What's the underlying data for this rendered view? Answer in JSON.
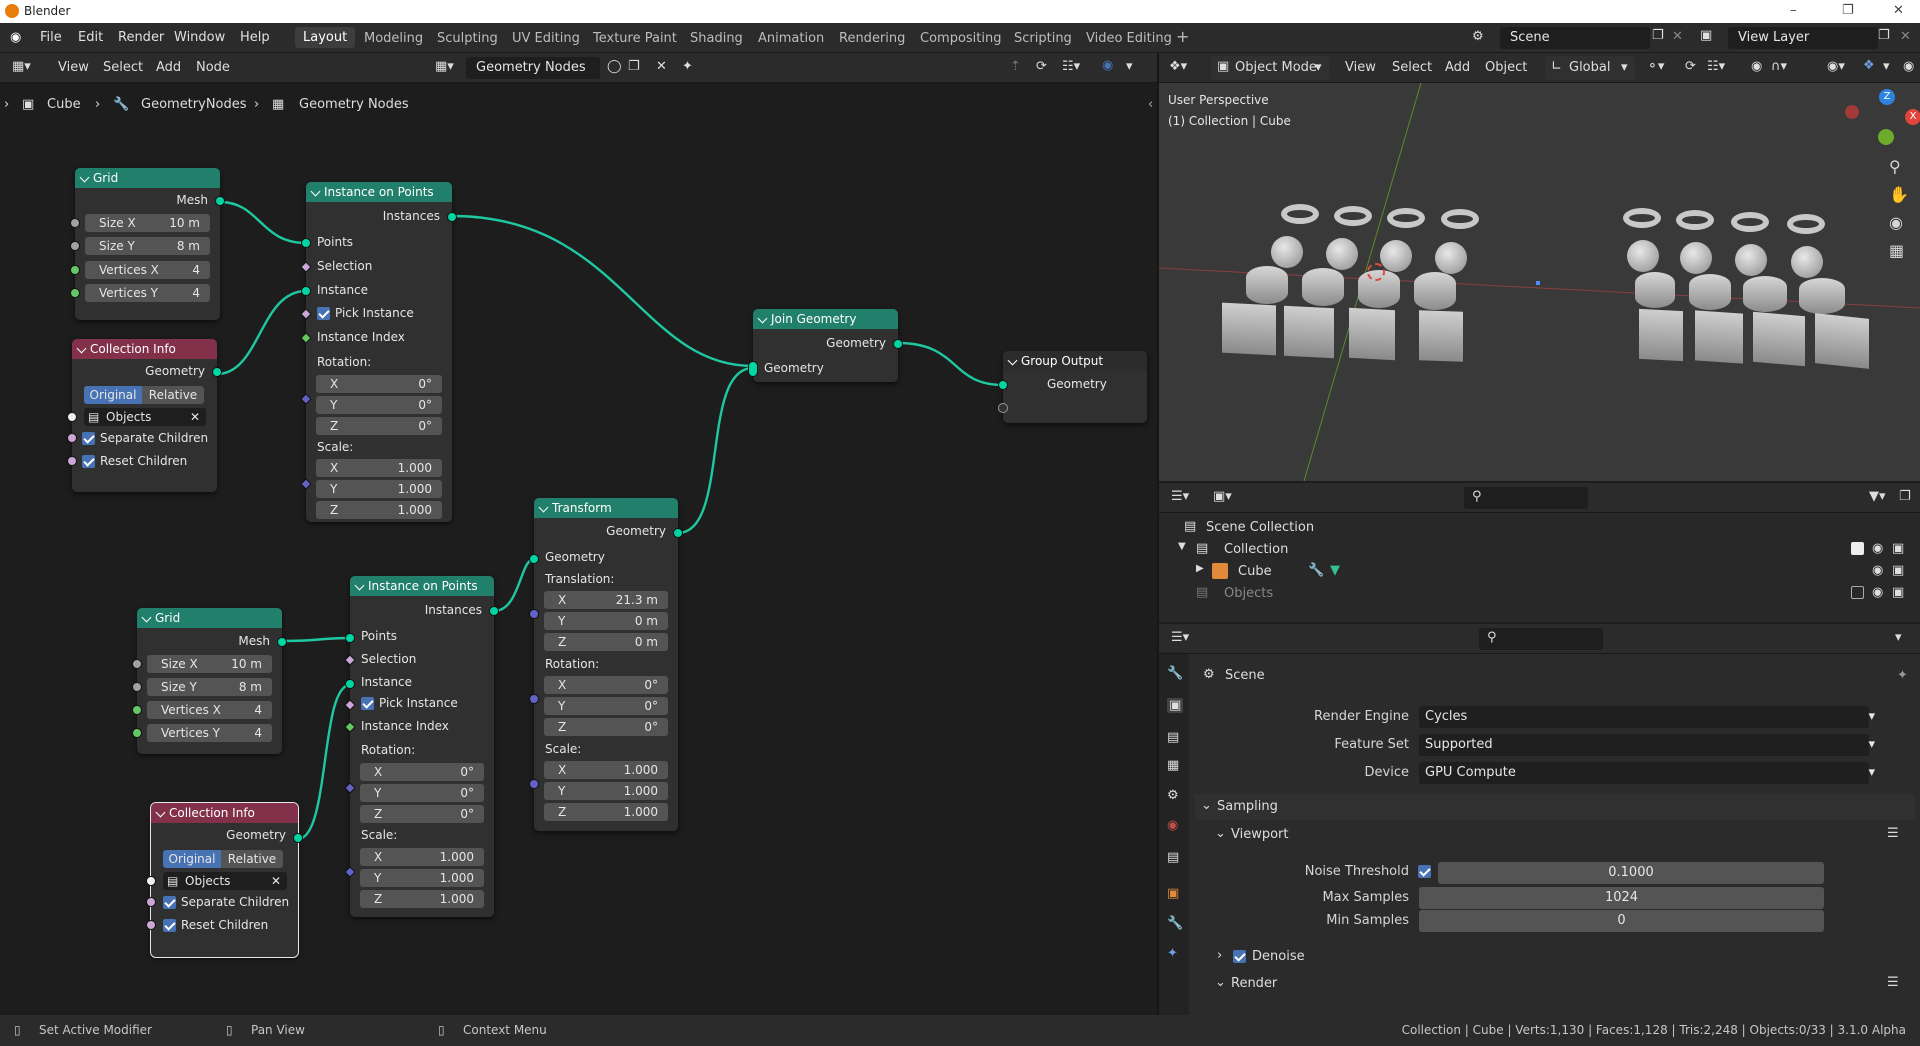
{
  "window": {
    "title": "Blender"
  },
  "menu": {
    "file": "File",
    "edit": "Edit",
    "render": "Render",
    "window": "Window",
    "help": "Help"
  },
  "workspaces": [
    "Layout",
    "Modeling",
    "Sculpting",
    "UV Editing",
    "Texture Paint",
    "Shading",
    "Animation",
    "Rendering",
    "Compositing",
    "Scripting",
    "Video Editing"
  ],
  "scene": {
    "name": "Scene",
    "view_layer": "View Layer"
  },
  "node_editor": {
    "menu": {
      "view": "View",
      "select": "Select",
      "add": "Add",
      "node": "Node"
    },
    "tree_name": "Geometry Nodes",
    "breadcrumb": {
      "object": "Cube",
      "modifier": "GeometryNodes",
      "tree": "Geometry Nodes"
    }
  },
  "nodes": {
    "grid1": {
      "title": "Grid",
      "mesh": "Mesh",
      "size_x_label": "Size X",
      "size_x": "10 m",
      "size_y_label": "Size Y",
      "size_y": "8 m",
      "vx_label": "Vertices X",
      "vx": "4",
      "vy_label": "Vertices Y",
      "vy": "4"
    },
    "grid2": {
      "title": "Grid",
      "mesh": "Mesh",
      "size_x_label": "Size X",
      "size_x": "10 m",
      "size_y_label": "Size Y",
      "size_y": "8 m",
      "vx_label": "Vertices X",
      "vx": "4",
      "vy_label": "Vertices Y",
      "vy": "4"
    },
    "ci1": {
      "title": "Collection Info",
      "geometry": "Geometry",
      "original": "Original",
      "relative": "Relative",
      "objects": "Objects",
      "separate": "Separate Children",
      "reset": "Reset Children"
    },
    "ci2": {
      "title": "Collection Info",
      "geometry": "Geometry",
      "original": "Original",
      "relative": "Relative",
      "objects": "Objects",
      "separate": "Separate Children",
      "reset": "Reset Children"
    },
    "iop1": {
      "title": "Instance on Points",
      "instances": "Instances",
      "points": "Points",
      "selection": "Selection",
      "instance": "Instance",
      "pick": "Pick Instance",
      "index": "Instance Index",
      "rotation": "Rotation:",
      "scale": "Scale:",
      "x": "X",
      "y": "Y",
      "z": "Z",
      "rx": "0°",
      "ry": "0°",
      "rz": "0°",
      "sx": "1.000",
      "sy": "1.000",
      "sz": "1.000"
    },
    "iop2": {
      "title": "Instance on Points",
      "instances": "Instances",
      "points": "Points",
      "selection": "Selection",
      "instance": "Instance",
      "pick": "Pick Instance",
      "index": "Instance Index",
      "rotation": "Rotation:",
      "scale": "Scale:",
      "x": "X",
      "y": "Y",
      "z": "Z",
      "rx": "0°",
      "ry": "0°",
      "rz": "0°",
      "sx": "1.000",
      "sy": "1.000",
      "sz": "1.000"
    },
    "transform": {
      "title": "Transform",
      "geometry_out": "Geometry",
      "geometry_in": "Geometry",
      "translation": "Translation:",
      "rotation": "Rotation:",
      "scale": "Scale:",
      "x": "X",
      "y": "Y",
      "z": "Z",
      "tx": "21.3 m",
      "ty": "0 m",
      "tz": "0 m",
      "rx": "0°",
      "ry": "0°",
      "rz": "0°",
      "sx": "1.000",
      "sy": "1.000",
      "sz": "1.000"
    },
    "join": {
      "title": "Join Geometry",
      "geometry_out": "Geometry",
      "geometry_in": "Geometry"
    },
    "group_output": {
      "title": "Group Output",
      "geometry": "Geometry"
    }
  },
  "viewport": {
    "mode": "Object Mode",
    "menu": {
      "view": "View",
      "select": "Select",
      "add": "Add",
      "object": "Object"
    },
    "orientation": "Global",
    "overlay_title": "User Perspective",
    "overlay_sub": "(1) Collection | Cube",
    "gizmo": {
      "x": "X",
      "y": "Y",
      "z": "Z"
    }
  },
  "outliner": {
    "items": [
      {
        "label": "Scene Collection"
      },
      {
        "label": "Collection"
      },
      {
        "label": "Cube"
      },
      {
        "label": "Objects"
      }
    ]
  },
  "properties": {
    "context": "Scene",
    "render_engine_label": "Render Engine",
    "render_engine": "Cycles",
    "feature_set_label": "Feature Set",
    "feature_set": "Supported",
    "device_label": "Device",
    "device": "GPU Compute",
    "sampling": "Sampling",
    "viewport": "Viewport",
    "noise_label": "Noise Threshold",
    "noise": "0.1000",
    "max_label": "Max Samples",
    "max": "1024",
    "min_label": "Min Samples",
    "min": "0",
    "denoise": "Denoise",
    "render": "Render"
  },
  "status": {
    "left1": "Set Active Modifier",
    "left2": "Pan View",
    "left3": "Context Menu",
    "right": "Collection | Cube | Verts:1,130 | Faces:1,128 | Tris:2,248 | Objects:0/33 | 3.1.0 Alpha"
  },
  "colors": {
    "accent": "#4772b3",
    "geometry_node": "#21806b",
    "input_node": "#83314a",
    "geometry_socket": "#00d6a3"
  }
}
